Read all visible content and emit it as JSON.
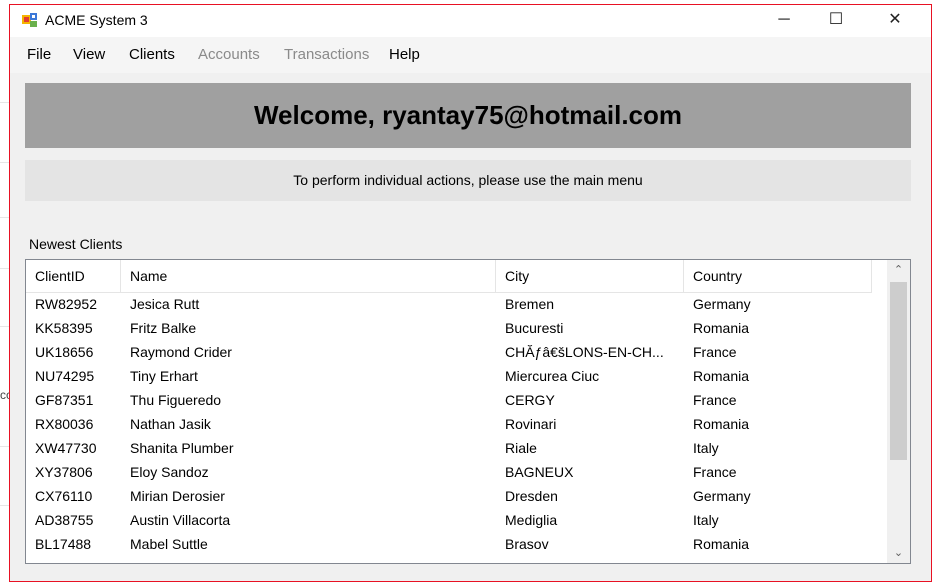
{
  "window": {
    "title": "ACME System 3"
  },
  "window_controls": {
    "minimize": "─",
    "maximize": "☐",
    "close": "✕"
  },
  "left_strip": {
    "fragment": "cc"
  },
  "menu": {
    "items": [
      "File",
      "View",
      "Clients",
      "Accounts",
      "Transactions",
      "Help"
    ],
    "disabled": [
      "Accounts",
      "Transactions"
    ]
  },
  "banner": {
    "welcome_text": "Welcome, ryantay75@hotmail.com"
  },
  "info_bar": {
    "text": "To perform individual actions, please use the main menu"
  },
  "clients_section": {
    "label": "Newest Clients"
  },
  "clients_table": {
    "columns": [
      "ClientID",
      "Name",
      "City",
      "Country"
    ],
    "rows": [
      [
        "RW82952",
        "Jesica Rutt",
        "Bremen",
        "Germany"
      ],
      [
        "KK58395",
        "Fritz Balke",
        "Bucuresti",
        "Romania"
      ],
      [
        "UK18656",
        "Raymond Crider",
        "CHĂƒâ€šLONS-EN-CH...",
        "France"
      ],
      [
        "NU74295",
        "Tiny Erhart",
        "Miercurea Ciuc",
        "Romania"
      ],
      [
        "GF87351",
        "Thu Figueredo",
        "CERGY",
        "France"
      ],
      [
        "RX80036",
        "Nathan Jasik",
        "Rovinari",
        "Romania"
      ],
      [
        "XW47730",
        "Shanita Plumber",
        "Riale",
        "Italy"
      ],
      [
        "XY37806",
        "Eloy Sandoz",
        "BAGNEUX",
        "France"
      ],
      [
        "CX76110",
        "Mirian Derosier",
        "Dresden",
        "Germany"
      ],
      [
        "AD38755",
        "Austin Villacorta",
        "Mediglia",
        "Italy"
      ],
      [
        "BL17488",
        "Mabel Suttle",
        "Brasov",
        "Romania"
      ],
      [
        "",
        "",
        "",
        ""
      ]
    ],
    "scrollbar": {
      "up": "⌃",
      "down": "⌄"
    }
  }
}
